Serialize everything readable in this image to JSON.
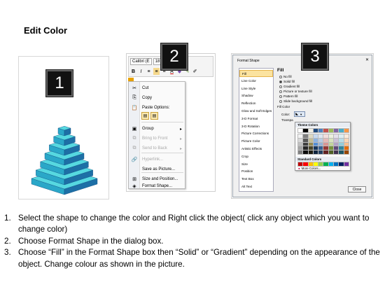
{
  "title": "Edit Color",
  "steps": [
    {
      "number": "1"
    },
    {
      "number": "2"
    },
    {
      "number": "3"
    }
  ],
  "toolbar": {
    "font_name": "Calibri (E",
    "font_size": "18",
    "bold": "B",
    "italic": "I",
    "font_color_icon": "A"
  },
  "context_menu": {
    "items": [
      {
        "label": "Cut",
        "icon": "scissors-icon",
        "glyph": "✂",
        "disabled": false
      },
      {
        "label": "Copy",
        "icon": "copy-icon",
        "glyph": "⎘",
        "disabled": false
      },
      {
        "label": "Paste Options:",
        "icon": "paste-icon",
        "glyph": "📋",
        "disabled": false
      },
      {
        "label": "Group",
        "icon": "group-icon",
        "glyph": "▣",
        "disabled": false,
        "submenu": true
      },
      {
        "label": "Bring to Front",
        "icon": "bring-front-icon",
        "glyph": "⧉",
        "disabled": true,
        "submenu": true
      },
      {
        "label": "Send to Back",
        "icon": "send-back-icon",
        "glyph": "⧉",
        "disabled": true,
        "submenu": true
      },
      {
        "label": "Hyperlink...",
        "icon": "hyperlink-icon",
        "glyph": "🔗",
        "disabled": true
      },
      {
        "label": "Save as Picture...",
        "icon": "save-picture-icon",
        "glyph": "",
        "disabled": false
      },
      {
        "label": "Size and Position...",
        "icon": "size-position-icon",
        "glyph": "⊞",
        "disabled": false
      },
      {
        "label": "Format Shape...",
        "icon": "format-shape-icon",
        "glyph": "◈",
        "disabled": false
      }
    ]
  },
  "dialog": {
    "title": "Format Shape",
    "categories": [
      "Fill",
      "Line Color",
      "Line Style",
      "Shadow",
      "Reflection",
      "Glow and Soft Edges",
      "3-D Format",
      "3-D Rotation",
      "Picture Corrections",
      "Picture Color",
      "Artistic Effects",
      "Crop",
      "Size",
      "Position",
      "Text Box",
      "Alt Text"
    ],
    "selected_category": "Fill",
    "section_heading": "Fill",
    "fill_options": [
      {
        "label": "No fill",
        "checked": false
      },
      {
        "label": "Solid fill",
        "checked": true
      },
      {
        "label": "Gradient fill",
        "checked": false
      },
      {
        "label": "Picture or texture fill",
        "checked": false
      },
      {
        "label": "Pattern fill",
        "checked": false
      },
      {
        "label": "Slide background fill",
        "checked": false
      }
    ],
    "fill_color_label": "Fill Color",
    "color_label": "Color:",
    "transparency_label": "Transpa",
    "close_label": "Close",
    "palette": {
      "theme_label": "Theme Colors",
      "standard_label": "Standard Colors",
      "more_colors_label": "More Colors...",
      "theme_top": [
        "#ffffff",
        "#000000",
        "#eeece1",
        "#1f497d",
        "#4f81bd",
        "#c0504d",
        "#9bbb59",
        "#8064a2",
        "#4bacc6",
        "#f79646"
      ],
      "theme_shades": [
        [
          "#f2f2f2",
          "#7f7f7f",
          "#ddd9c3",
          "#c6d9f0",
          "#dbe5f1",
          "#f2dcdb",
          "#ebf1dd",
          "#e5e0ec",
          "#dbeef3",
          "#fdeada"
        ],
        [
          "#d8d8d8",
          "#595959",
          "#c4bd97",
          "#8db3e2",
          "#b8cce4",
          "#e5b9b7",
          "#d7e3bc",
          "#ccc1d9",
          "#b7dde8",
          "#fbd5b5"
        ],
        [
          "#bfbfbf",
          "#3f3f3f",
          "#938953",
          "#548dd4",
          "#95b3d7",
          "#d99694",
          "#c3d69b",
          "#b2a2c7",
          "#92cddc",
          "#fac08f"
        ],
        [
          "#a5a5a5",
          "#262626",
          "#494429",
          "#17365d",
          "#366092",
          "#953734",
          "#76923c",
          "#5f497a",
          "#31859b",
          "#e36c09"
        ],
        [
          "#7f7f7f",
          "#0c0c0c",
          "#1d1b10",
          "#0f243e",
          "#244061",
          "#632423",
          "#4f6128",
          "#3f3151",
          "#205867",
          "#974806"
        ]
      ],
      "standard": [
        "#c00000",
        "#ff0000",
        "#ffc000",
        "#ffff00",
        "#92d050",
        "#00b050",
        "#00b0f0",
        "#0070c0",
        "#002060",
        "#7030a0"
      ]
    }
  },
  "pyramid": {
    "colors": {
      "top": "#56d8e0",
      "front": "#2aa7c8",
      "side": "#1d6fa6",
      "edge": "#0f4d80"
    },
    "layers": 7
  },
  "instructions": [
    {
      "num": "1.",
      "text": "Select the shape to change the color and Right click the object( click any object which you want to change color)"
    },
    {
      "num": "2.",
      "text": "Choose Format Shape in the dialog box."
    },
    {
      "num": "3.",
      "text": "Choose “Fill” in the Format Shape box then “Solid” or “Gradient” depending on the appearance of the object. Change colour as shown in the picture."
    }
  ]
}
